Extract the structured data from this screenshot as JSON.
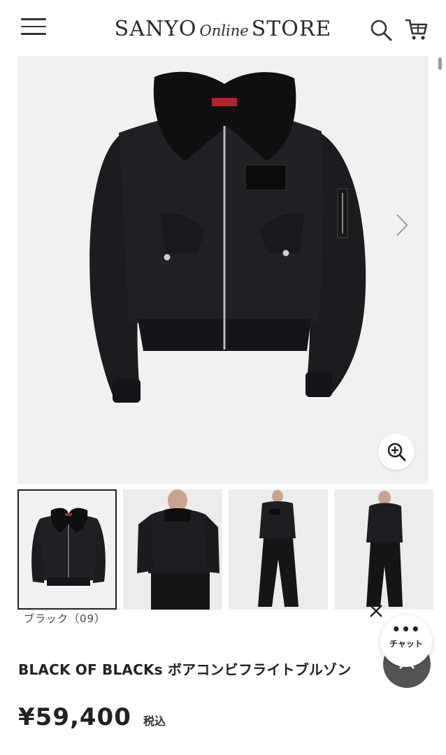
{
  "header": {
    "logo_main": "SANYO",
    "logo_online": "Online",
    "logo_store": "STORE"
  },
  "gallery": {
    "thumbnails": [
      "jacket-flat",
      "model-front",
      "model-full-front",
      "model-full-side"
    ],
    "active_index": 0
  },
  "product": {
    "color_label": "ブラック（09）",
    "title": "BLACK OF BLACKs ボアコンビフライトブルゾン",
    "price": "¥59,400",
    "tax_label": "税込"
  },
  "chat": {
    "dots": "•••",
    "label": "チャット"
  },
  "icons": {
    "menu": "hamburger-icon",
    "search": "search-icon",
    "cart": "cart-icon",
    "next": "chevron-right-icon",
    "zoom": "zoom-in-icon",
    "close": "close-icon",
    "scroll_top": "chevron-up-icon"
  },
  "colors": {
    "text": "#222222",
    "image_bg": "#f1f1f1",
    "scroll_top_bg": "#555555"
  }
}
